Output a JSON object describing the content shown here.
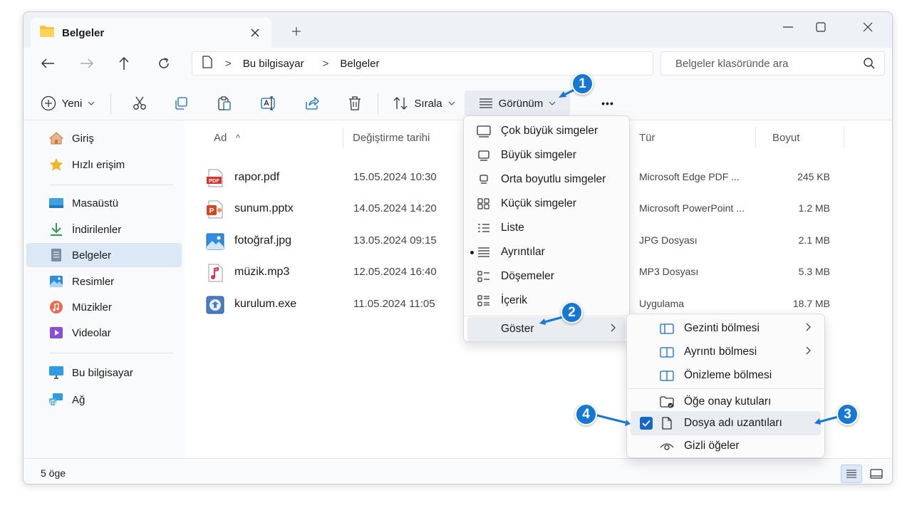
{
  "window": {
    "tab_title": "Belgeler"
  },
  "address": {
    "crumbs": [
      "Bu bilgisayar",
      "Belgeler"
    ],
    "separator": ">",
    "search_placeholder": "Belgeler klasöründe ara"
  },
  "toolbar": {
    "new_label": "Yeni",
    "sort_label": "Sırala",
    "view_label": "Görünüm",
    "more_label": "•••"
  },
  "sidebar": {
    "items": [
      {
        "label": "Giriş",
        "icon": "home-icon"
      },
      {
        "label": "Hızlı erişim",
        "icon": "star-icon"
      },
      {
        "label": "Masaüstü",
        "icon": "desktop-icon"
      },
      {
        "label": "İndirilenler",
        "icon": "download-icon"
      },
      {
        "label": "Belgeler",
        "icon": "documents-icon"
      },
      {
        "label": "Resimler",
        "icon": "pictures-icon"
      },
      {
        "label": "Müzikler",
        "icon": "music-icon"
      },
      {
        "label": "Videolar",
        "icon": "videos-icon"
      },
      {
        "label": "Bu bilgisayar",
        "icon": "computer-icon"
      },
      {
        "label": "Ağ",
        "icon": "network-icon"
      }
    ]
  },
  "columns": {
    "name": "Ad",
    "sort_arrow": "^",
    "date": "Değiştirme tarihi",
    "type": "Tür",
    "size": "Boyut"
  },
  "files": [
    {
      "name": "rapor.pdf",
      "date": "15.05.2024 10:30",
      "type": "Microsoft Edge PDF ...",
      "size": "245 KB",
      "icon": "pdf-icon"
    },
    {
      "name": "sunum.pptx",
      "date": "14.05.2024 14:20",
      "type": "Microsoft PowerPoint ...",
      "size": "1.2 MB",
      "icon": "pptx-icon"
    },
    {
      "name": "fotoğraf.jpg",
      "date": "13.05.2024 09:15",
      "type": "JPG Dosyası",
      "size": "2.1 MB",
      "icon": "image-icon"
    },
    {
      "name": "müzik.mp3",
      "date": "12.05.2024 16:40",
      "type": "MP3 Dosyası",
      "size": "5.3 MB",
      "icon": "audio-icon"
    },
    {
      "name": "kurulum.exe",
      "date": "11.05.2024 11:05",
      "type": "Uygulama",
      "size": "18.7 MB",
      "icon": "installer-icon"
    }
  ],
  "pdf_badge": "PDF",
  "pptx_badge": "P",
  "status": {
    "count": "5 öge"
  },
  "view_menu": {
    "items": [
      "Çok büyük simgeler",
      "Büyük simgeler",
      "Orta boyutlu simgeler",
      "Küçük simgeler",
      "Liste",
      "Ayrıntılar",
      "Döşemeler",
      "İçerik"
    ],
    "show_label": "Göster"
  },
  "show_menu": {
    "items": [
      "Gezinti bölmesi",
      "Ayrıntı bölmesi",
      "Önizleme bölmesi",
      "Öğe onay kutuları",
      "Dosya adı uzantıları",
      "Gizli öğeler"
    ]
  },
  "callouts": [
    "1",
    "2",
    "3",
    "4"
  ],
  "colors": {
    "accent": "#1468c8",
    "callout": "#1478d4",
    "selected_bg": "#dce8f5",
    "folder": "#f5c342"
  }
}
